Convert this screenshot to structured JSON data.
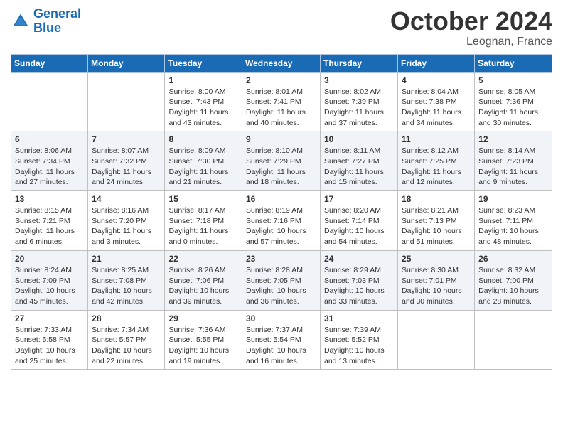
{
  "header": {
    "logo_line1": "General",
    "logo_line2": "Blue",
    "month": "October 2024",
    "location": "Leognan, France"
  },
  "weekdays": [
    "Sunday",
    "Monday",
    "Tuesday",
    "Wednesday",
    "Thursday",
    "Friday",
    "Saturday"
  ],
  "weeks": [
    [
      {
        "day": "",
        "sunrise": "",
        "sunset": "",
        "daylight": ""
      },
      {
        "day": "",
        "sunrise": "",
        "sunset": "",
        "daylight": ""
      },
      {
        "day": "1",
        "sunrise": "Sunrise: 8:00 AM",
        "sunset": "Sunset: 7:43 PM",
        "daylight": "Daylight: 11 hours and 43 minutes."
      },
      {
        "day": "2",
        "sunrise": "Sunrise: 8:01 AM",
        "sunset": "Sunset: 7:41 PM",
        "daylight": "Daylight: 11 hours and 40 minutes."
      },
      {
        "day": "3",
        "sunrise": "Sunrise: 8:02 AM",
        "sunset": "Sunset: 7:39 PM",
        "daylight": "Daylight: 11 hours and 37 minutes."
      },
      {
        "day": "4",
        "sunrise": "Sunrise: 8:04 AM",
        "sunset": "Sunset: 7:38 PM",
        "daylight": "Daylight: 11 hours and 34 minutes."
      },
      {
        "day": "5",
        "sunrise": "Sunrise: 8:05 AM",
        "sunset": "Sunset: 7:36 PM",
        "daylight": "Daylight: 11 hours and 30 minutes."
      }
    ],
    [
      {
        "day": "6",
        "sunrise": "Sunrise: 8:06 AM",
        "sunset": "Sunset: 7:34 PM",
        "daylight": "Daylight: 11 hours and 27 minutes."
      },
      {
        "day": "7",
        "sunrise": "Sunrise: 8:07 AM",
        "sunset": "Sunset: 7:32 PM",
        "daylight": "Daylight: 11 hours and 24 minutes."
      },
      {
        "day": "8",
        "sunrise": "Sunrise: 8:09 AM",
        "sunset": "Sunset: 7:30 PM",
        "daylight": "Daylight: 11 hours and 21 minutes."
      },
      {
        "day": "9",
        "sunrise": "Sunrise: 8:10 AM",
        "sunset": "Sunset: 7:29 PM",
        "daylight": "Daylight: 11 hours and 18 minutes."
      },
      {
        "day": "10",
        "sunrise": "Sunrise: 8:11 AM",
        "sunset": "Sunset: 7:27 PM",
        "daylight": "Daylight: 11 hours and 15 minutes."
      },
      {
        "day": "11",
        "sunrise": "Sunrise: 8:12 AM",
        "sunset": "Sunset: 7:25 PM",
        "daylight": "Daylight: 11 hours and 12 minutes."
      },
      {
        "day": "12",
        "sunrise": "Sunrise: 8:14 AM",
        "sunset": "Sunset: 7:23 PM",
        "daylight": "Daylight: 11 hours and 9 minutes."
      }
    ],
    [
      {
        "day": "13",
        "sunrise": "Sunrise: 8:15 AM",
        "sunset": "Sunset: 7:21 PM",
        "daylight": "Daylight: 11 hours and 6 minutes."
      },
      {
        "day": "14",
        "sunrise": "Sunrise: 8:16 AM",
        "sunset": "Sunset: 7:20 PM",
        "daylight": "Daylight: 11 hours and 3 minutes."
      },
      {
        "day": "15",
        "sunrise": "Sunrise: 8:17 AM",
        "sunset": "Sunset: 7:18 PM",
        "daylight": "Daylight: 11 hours and 0 minutes."
      },
      {
        "day": "16",
        "sunrise": "Sunrise: 8:19 AM",
        "sunset": "Sunset: 7:16 PM",
        "daylight": "Daylight: 10 hours and 57 minutes."
      },
      {
        "day": "17",
        "sunrise": "Sunrise: 8:20 AM",
        "sunset": "Sunset: 7:14 PM",
        "daylight": "Daylight: 10 hours and 54 minutes."
      },
      {
        "day": "18",
        "sunrise": "Sunrise: 8:21 AM",
        "sunset": "Sunset: 7:13 PM",
        "daylight": "Daylight: 10 hours and 51 minutes."
      },
      {
        "day": "19",
        "sunrise": "Sunrise: 8:23 AM",
        "sunset": "Sunset: 7:11 PM",
        "daylight": "Daylight: 10 hours and 48 minutes."
      }
    ],
    [
      {
        "day": "20",
        "sunrise": "Sunrise: 8:24 AM",
        "sunset": "Sunset: 7:09 PM",
        "daylight": "Daylight: 10 hours and 45 minutes."
      },
      {
        "day": "21",
        "sunrise": "Sunrise: 8:25 AM",
        "sunset": "Sunset: 7:08 PM",
        "daylight": "Daylight: 10 hours and 42 minutes."
      },
      {
        "day": "22",
        "sunrise": "Sunrise: 8:26 AM",
        "sunset": "Sunset: 7:06 PM",
        "daylight": "Daylight: 10 hours and 39 minutes."
      },
      {
        "day": "23",
        "sunrise": "Sunrise: 8:28 AM",
        "sunset": "Sunset: 7:05 PM",
        "daylight": "Daylight: 10 hours and 36 minutes."
      },
      {
        "day": "24",
        "sunrise": "Sunrise: 8:29 AM",
        "sunset": "Sunset: 7:03 PM",
        "daylight": "Daylight: 10 hours and 33 minutes."
      },
      {
        "day": "25",
        "sunrise": "Sunrise: 8:30 AM",
        "sunset": "Sunset: 7:01 PM",
        "daylight": "Daylight: 10 hours and 30 minutes."
      },
      {
        "day": "26",
        "sunrise": "Sunrise: 8:32 AM",
        "sunset": "Sunset: 7:00 PM",
        "daylight": "Daylight: 10 hours and 28 minutes."
      }
    ],
    [
      {
        "day": "27",
        "sunrise": "Sunrise: 7:33 AM",
        "sunset": "Sunset: 5:58 PM",
        "daylight": "Daylight: 10 hours and 25 minutes."
      },
      {
        "day": "28",
        "sunrise": "Sunrise: 7:34 AM",
        "sunset": "Sunset: 5:57 PM",
        "daylight": "Daylight: 10 hours and 22 minutes."
      },
      {
        "day": "29",
        "sunrise": "Sunrise: 7:36 AM",
        "sunset": "Sunset: 5:55 PM",
        "daylight": "Daylight: 10 hours and 19 minutes."
      },
      {
        "day": "30",
        "sunrise": "Sunrise: 7:37 AM",
        "sunset": "Sunset: 5:54 PM",
        "daylight": "Daylight: 10 hours and 16 minutes."
      },
      {
        "day": "31",
        "sunrise": "Sunrise: 7:39 AM",
        "sunset": "Sunset: 5:52 PM",
        "daylight": "Daylight: 10 hours and 13 minutes."
      },
      {
        "day": "",
        "sunrise": "",
        "sunset": "",
        "daylight": ""
      },
      {
        "day": "",
        "sunrise": "",
        "sunset": "",
        "daylight": ""
      }
    ]
  ]
}
